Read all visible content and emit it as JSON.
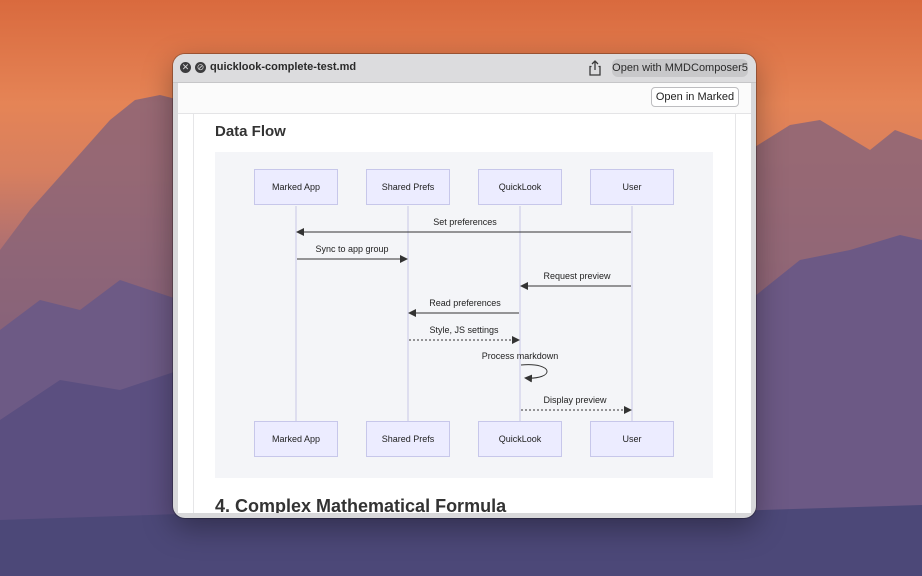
{
  "window": {
    "title": "quicklook-complete-test.md",
    "open_with_label": "Open with MMDComposer5",
    "close_glyph": "✕",
    "minimize_glyph": "⊘"
  },
  "toolbar": {
    "open_in_marked_label": "Open in Marked"
  },
  "document": {
    "section_heading": "Data Flow",
    "next_heading": "4. Complex Mathematical Formula"
  },
  "diagram": {
    "type": "sequence",
    "actors": [
      "Marked App",
      "Shared Prefs",
      "QuickLook",
      "User"
    ],
    "messages": [
      {
        "label": "Set preferences",
        "from": "User",
        "to": "Marked App",
        "style": "solid"
      },
      {
        "label": "Sync to app group",
        "from": "Marked App",
        "to": "Shared Prefs",
        "style": "solid"
      },
      {
        "label": "Request preview",
        "from": "User",
        "to": "QuickLook",
        "style": "solid"
      },
      {
        "label": "Read preferences",
        "from": "QuickLook",
        "to": "Shared Prefs",
        "style": "solid"
      },
      {
        "label": "Style, JS settings",
        "from": "Shared Prefs",
        "to": "QuickLook",
        "style": "dashed"
      },
      {
        "label": "Process markdown",
        "from": "QuickLook",
        "to": "QuickLook",
        "style": "self"
      },
      {
        "label": "Display preview",
        "from": "QuickLook",
        "to": "User",
        "style": "dashed"
      }
    ],
    "colors": {
      "actor_fill": "#ececff",
      "actor_border": "#c7c7ea",
      "lifeline": "#c8c8e6",
      "arrow": "#333333",
      "background": "#f4f5f8"
    }
  },
  "icons": {
    "share": "share-icon",
    "close": "close-icon",
    "minimize": "minimize-icon"
  }
}
